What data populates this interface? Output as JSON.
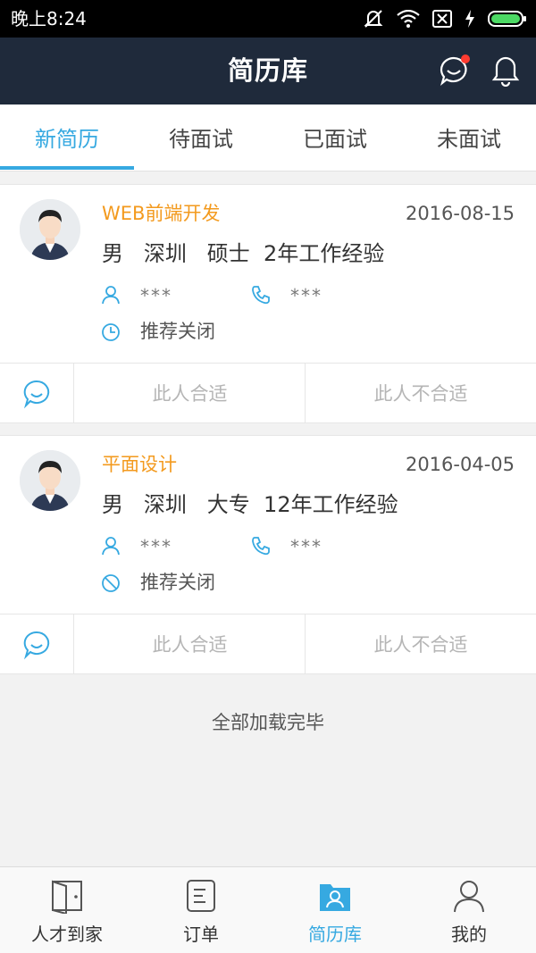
{
  "status_bar": {
    "time": "晚上8:24"
  },
  "header": {
    "title": "简历库",
    "icons": [
      "chat-icon",
      "bell-icon"
    ],
    "notification_dot": true
  },
  "tabs": [
    {
      "label": "新简历",
      "active": true
    },
    {
      "label": "待面试",
      "active": false
    },
    {
      "label": "已面试",
      "active": false
    },
    {
      "label": "未面试",
      "active": false
    }
  ],
  "resumes": [
    {
      "job_title": "WEB前端开发",
      "date": "2016-08-15",
      "gender": "男",
      "city": "深圳",
      "education": "硕士",
      "experience": "2年工作经验",
      "name_masked": "***",
      "phone_masked": "***",
      "status_icon": "clock-icon",
      "status_text": "推荐关闭",
      "action_fit": "此人合适",
      "action_unfit": "此人不合适"
    },
    {
      "job_title": "平面设计",
      "date": "2016-04-05",
      "gender": "男",
      "city": "深圳",
      "education": "大专",
      "experience": "12年工作经验",
      "name_masked": "***",
      "phone_masked": "***",
      "status_icon": "ban-icon",
      "status_text": "推荐关闭",
      "action_fit": "此人合适",
      "action_unfit": "此人不合适"
    }
  ],
  "list_footer": "全部加载完毕",
  "bottom_nav": [
    {
      "label": "人才到家",
      "icon": "door-icon",
      "active": false
    },
    {
      "label": "订单",
      "icon": "document-icon",
      "active": false
    },
    {
      "label": "简历库",
      "icon": "resume-folder-icon",
      "active": true
    },
    {
      "label": "我的",
      "icon": "user-icon",
      "active": false
    }
  ],
  "colors": {
    "accent": "#36a9e1",
    "header_bg": "#1f2a3b",
    "job_title": "#f39a1e",
    "badge": "#ff3b30"
  }
}
